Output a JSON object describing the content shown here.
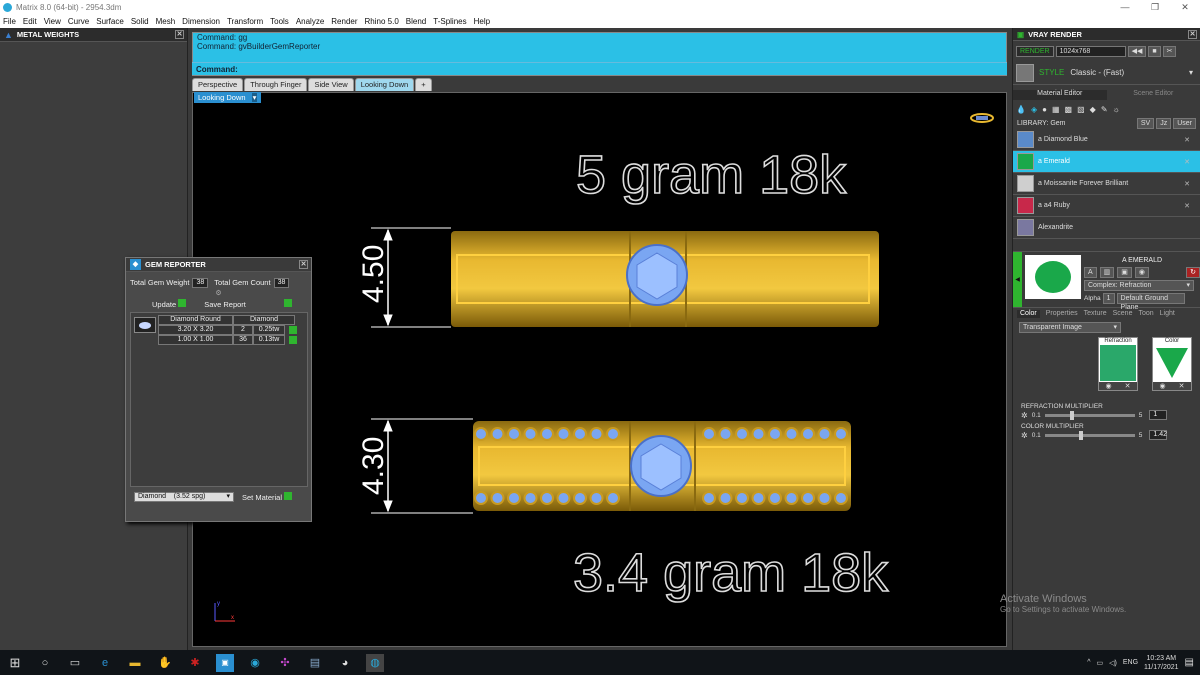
{
  "window": {
    "title": "Matrix 8.0 (64-bit) - 2954.3dm",
    "controls": [
      "—",
      "❐",
      "✕"
    ]
  },
  "menu": [
    "File",
    "Edit",
    "View",
    "Curve",
    "Surface",
    "Solid",
    "Mesh",
    "Dimension",
    "Transform",
    "Tools",
    "Analyze",
    "Render",
    "Rhino 5.0",
    "Blend",
    "T-Splines",
    "Help"
  ],
  "left_panel": {
    "title": "METAL WEIGHTS"
  },
  "command": {
    "lines": [
      "Command: gg",
      "Command: gvBuilderGemReporter"
    ],
    "prompt": "Command:"
  },
  "view_tabs": [
    "Perspective",
    "Through Finger",
    "Side View",
    "Looking Down",
    "+"
  ],
  "active_view": "Looking Down",
  "viewport": {
    "top_label": "5 gram 18k",
    "bottom_label": "3.4 gram 18k",
    "dim_top": "4.50",
    "dim_bottom": "4.30",
    "axis_y": "y",
    "axis_x": "x"
  },
  "gem_reporter": {
    "title": "GEM REPORTER",
    "weight_label": "Total Gem Weight",
    "weight_value": "38",
    "count_label": "Total Gem Count",
    "count_value": "38",
    "update_label": "Update",
    "save_label": "Save Report",
    "table_header": [
      "Diamond Round",
      "Diamond"
    ],
    "rows": [
      {
        "size": "3.20 X 3.20",
        "count": "2",
        "tw": "0.25tw"
      },
      {
        "size": "1.00 X 1.00",
        "count": "36",
        "tw": "0.13tw"
      }
    ],
    "material_select": "Diamond    (3.52 spg)",
    "set_material": "Set Material"
  },
  "vray": {
    "title": "VRAY RENDER",
    "render_label": "RENDER",
    "resolution": "1024x768",
    "style_label": "STYLE",
    "style_value": "Classic - (Fast)",
    "tabs": [
      "Material Editor",
      "Scene Editor"
    ],
    "library_label": "LIBRARY: Gem",
    "library_btns": [
      "SV",
      "Jz",
      "User"
    ],
    "materials": [
      {
        "name": "a Diamond Blue",
        "color": "#5a8ac9"
      },
      {
        "name": "a Emerald",
        "color": "#1aa84a"
      },
      {
        "name": "a Moissanite Forever Brilliant",
        "color": "#cfcfcf"
      },
      {
        "name": "a a4 Ruby",
        "color": "#c8284a"
      },
      {
        "name": "Alexandrite",
        "color": "#7a78a0"
      }
    ],
    "selected_material": "A EMERALD",
    "material_type": "Complex: Refraction",
    "alpha_label": "Alpha",
    "ground_plane": "Default Ground Plane",
    "subtabs": [
      "Color",
      "Properties",
      "Texture",
      "Scene",
      "Toon",
      "Light"
    ],
    "transparency": "Transparent Image",
    "refraction_label": "Refraction",
    "color_label": "Color",
    "refraction_mult_label": "REFRACTION MULTIPLIER",
    "refraction_min": "0.1",
    "refraction_max": "5",
    "refraction_value": "1",
    "color_mult_label": "COLOR MULTIPLIER",
    "color_min": "0.1",
    "color_max": "5",
    "color_value": "1.42"
  },
  "activate": {
    "line1": "Activate Windows",
    "line2": "Go to Settings to activate Windows."
  },
  "taskbar": {
    "lang": "ENG",
    "time": "10:23 AM",
    "date": "11/17/2021"
  }
}
